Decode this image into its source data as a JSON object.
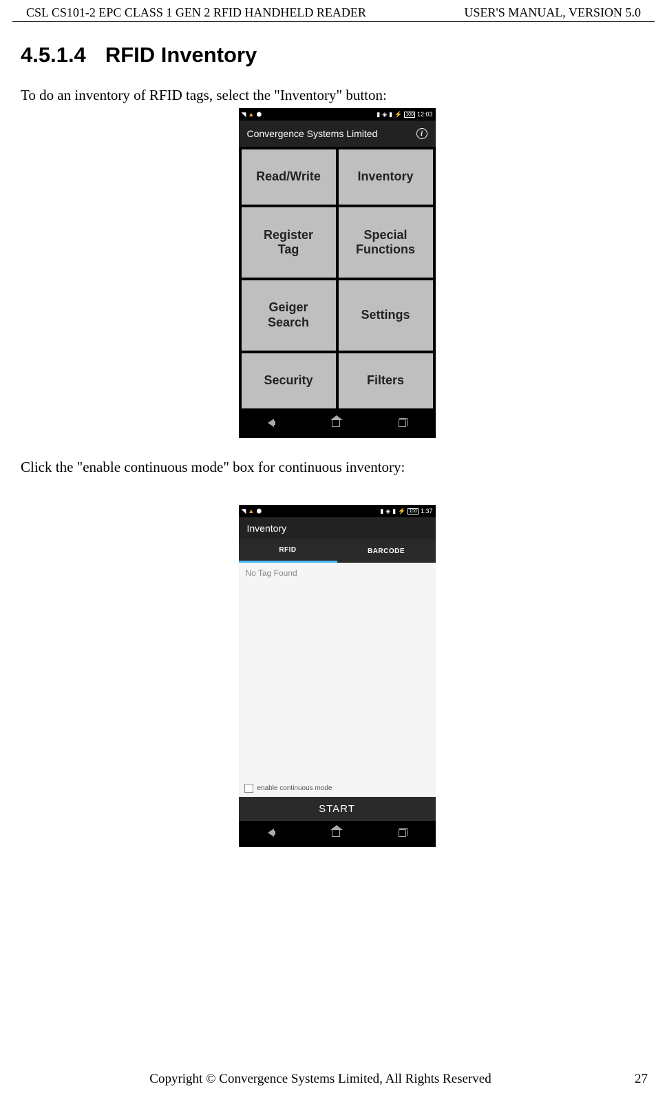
{
  "header": {
    "left": "CSL CS101-2 EPC CLASS 1 GEN 2 RFID HANDHELD READER",
    "right": "USER'S  MANUAL,  VERSION  5.0"
  },
  "section": {
    "number": "4.5.1.4",
    "title": "RFID Inventory"
  },
  "body": {
    "para1": "To do an inventory of RFID tags, select the \"Inventory\" button:",
    "para2": "Click the \"enable continuous mode\" box for continuous inventory:"
  },
  "screenshot1": {
    "status_time": "12:03",
    "status_battery": "100",
    "app_title": "Convergence Systems Limited",
    "menu": {
      "read_write": "Read/Write",
      "inventory": "Inventory",
      "register_tag": "Register\nTag",
      "special_functions": "Special\nFunctions",
      "geiger_search": "Geiger\nSearch",
      "settings": "Settings",
      "security": "Security",
      "filters": "Filters"
    }
  },
  "screenshot2": {
    "status_time": "1:37",
    "status_battery": "100",
    "app_title": "Inventory",
    "tab_rfid": "RFID",
    "tab_barcode": "BARCODE",
    "no_tag": "No Tag Found",
    "checkbox_label": "enable continuous mode",
    "start_button": "START"
  },
  "footer": {
    "copyright": "Copyright © Convergence Systems Limited, All Rights Reserved",
    "page": "27"
  }
}
